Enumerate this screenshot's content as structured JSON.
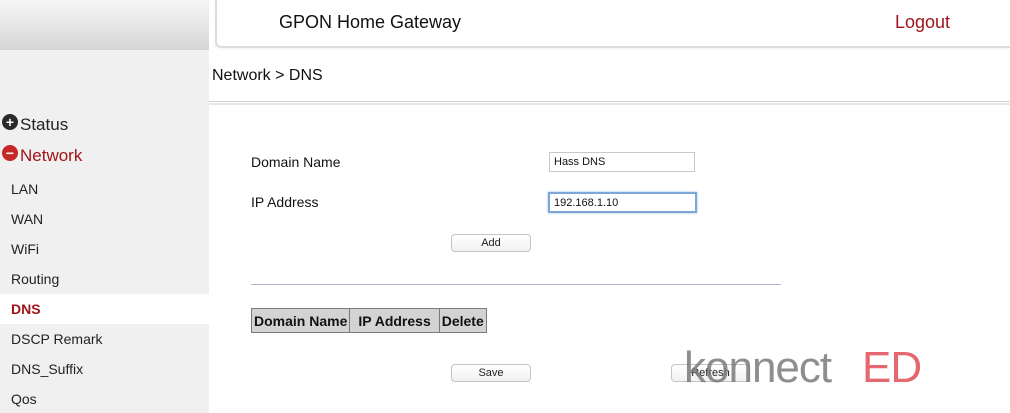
{
  "header": {
    "title": "GPON Home Gateway",
    "logout_label": "Logout"
  },
  "sidebar": {
    "groups": [
      {
        "label": "Status",
        "icon": "plus-circle-icon"
      },
      {
        "label": "Network",
        "icon": "minus-circle-icon"
      }
    ],
    "items": [
      "LAN",
      "WAN",
      "WiFi",
      "Routing",
      "DNS",
      "DSCP Remark",
      "DNS_Suffix",
      "Qos"
    ],
    "active_item": "DNS"
  },
  "breadcrumb": "Network > DNS",
  "form": {
    "domain_label": "Domain Name",
    "domain_value": "Hass DNS",
    "ip_label": "IP Address",
    "ip_value": "192.168.1.10",
    "add_label": "Add"
  },
  "table": {
    "headers": [
      "Domain Name",
      "IP Address",
      "Delete"
    ]
  },
  "buttons": {
    "save_label": "Save",
    "refresh_label": "Refresh"
  },
  "watermark": {
    "text_dark": "konnect",
    "text_accent": "ED"
  },
  "colors": {
    "accent_red": "#a0141c",
    "sidebar_bg": "#f0f0f0",
    "watermark_red": "#e2565f",
    "watermark_gray": "#7a7a7a"
  }
}
